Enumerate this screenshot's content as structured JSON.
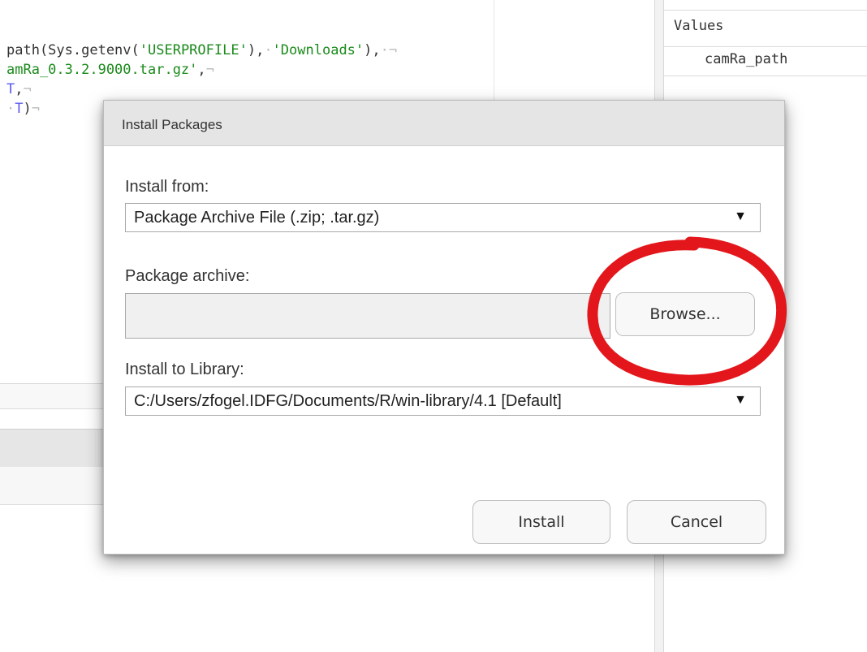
{
  "editor": {
    "lines": [
      [
        {
          "t": "path(Sys.getenv(",
          "c": "fn"
        },
        {
          "t": "'USERPROFILE'",
          "c": "str"
        },
        {
          "t": "),",
          "c": "fn"
        },
        {
          "t": "·",
          "c": "ws"
        },
        {
          "t": "'Downloads'",
          "c": "str"
        },
        {
          "t": "),",
          "c": "fn"
        },
        {
          "t": "·¬",
          "c": "ws"
        }
      ],
      [
        {
          "t": "amRa_0.3.2.9000.tar.gz'",
          "c": "str"
        },
        {
          "t": ",",
          "c": "fn"
        },
        {
          "t": "¬",
          "c": "ws"
        }
      ],
      [
        {
          "t": "T",
          "c": "const"
        },
        {
          "t": ",",
          "c": "fn"
        },
        {
          "t": "¬",
          "c": "ws"
        }
      ],
      [
        {
          "t": "·",
          "c": "ws"
        },
        {
          "t": "T",
          "c": "const"
        },
        {
          "t": ")",
          "c": "fn"
        },
        {
          "t": "¬",
          "c": "ws"
        }
      ]
    ]
  },
  "environment": {
    "section_header": "Values",
    "rows": [
      "camRa_path"
    ]
  },
  "dialog": {
    "title": "Install Packages",
    "install_from": {
      "label": "Install from:",
      "value": "Package Archive File (.zip; .tar.gz)",
      "arrow_icon": "dropdown-arrow-icon"
    },
    "package_archive": {
      "label": "Package archive:",
      "value": "",
      "browse_label": "Browse..."
    },
    "install_to": {
      "label": "Install to Library:",
      "value": "C:/Users/zfogel.IDFG/Documents/R/win-library/4.1 [Default]",
      "arrow_icon": "dropdown-arrow-icon"
    },
    "buttons": {
      "install_label": "Install",
      "cancel_label": "Cancel"
    }
  },
  "colors": {
    "annotation_red": "#e3161c",
    "string_green": "#1b8a1b",
    "constant_blue": "#5b5bf0"
  }
}
